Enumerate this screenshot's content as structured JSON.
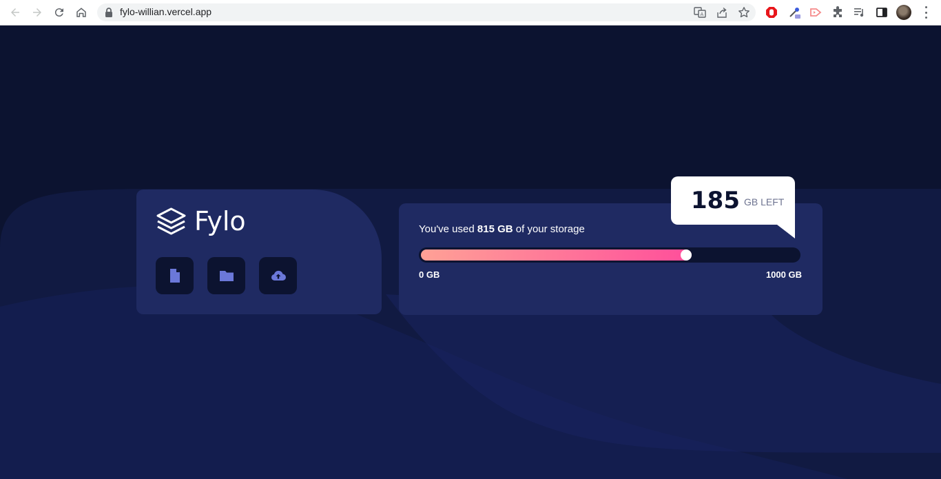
{
  "browser": {
    "url": "fylo-willian.vercel.app"
  },
  "brand": {
    "name": "Fylo",
    "tiles": [
      {
        "icon": "document-icon"
      },
      {
        "icon": "folder-icon"
      },
      {
        "icon": "upload-icon"
      }
    ]
  },
  "storage": {
    "prefix": "You've used ",
    "used_value": "815 GB",
    "suffix": " of your storage",
    "used_gb": 815,
    "total_gb": 1000,
    "min_label": "0 GB",
    "max_label": "1000 GB",
    "remaining_value": "185",
    "remaining_unit": "GB LEFT"
  },
  "colors": {
    "page_bg": "#0c1330",
    "card_bg": "#1f2a62",
    "gradient_start": "#ffa196",
    "gradient_end": "#ff4e9b",
    "icon_accent": "#6b78d9"
  }
}
